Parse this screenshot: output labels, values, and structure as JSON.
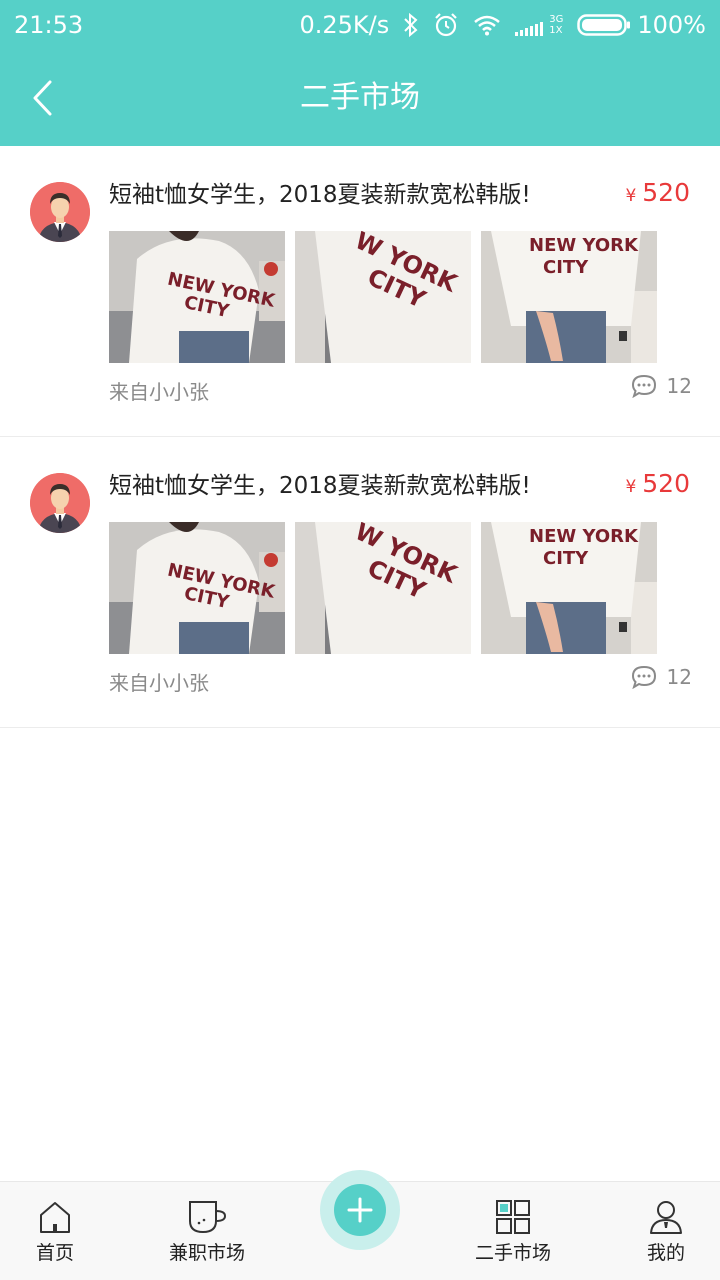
{
  "status_bar": {
    "time": "21:53",
    "speed": "0.25K/s",
    "network": "3G",
    "network_sub": "1X",
    "battery": "100%"
  },
  "nav": {
    "title": "二手市场",
    "back_icon": "chevron-left-icon"
  },
  "posts": [
    {
      "title": "短袖t恤女学生，2018夏装新款宽松韩版!",
      "currency": "¥",
      "price": "520",
      "author": "来自小小张",
      "comments": "12"
    },
    {
      "title": "短袖t恤女学生，2018夏装新款宽松韩版!",
      "currency": "¥",
      "price": "520",
      "author": "来自小小张",
      "comments": "12"
    }
  ],
  "tabs": [
    {
      "label": "首页",
      "icon": "home-icon"
    },
    {
      "label": "兼职市场",
      "icon": "cup-icon"
    },
    {
      "label": "",
      "icon": "plus-icon"
    },
    {
      "label": "二手市场",
      "icon": "grid-icon"
    },
    {
      "label": "我的",
      "icon": "user-icon"
    }
  ],
  "colors": {
    "accent": "#56d0c8",
    "price": "#e8393a",
    "muted": "#8a8a8a"
  }
}
